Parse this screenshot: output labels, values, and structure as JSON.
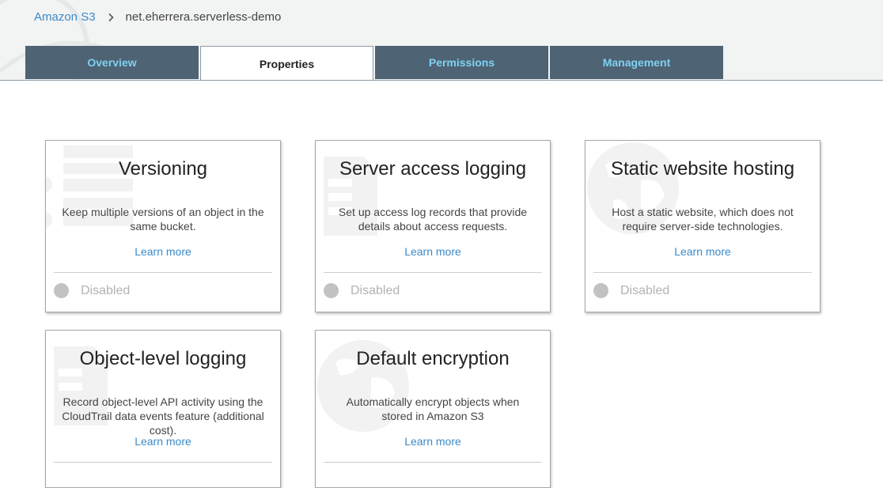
{
  "breadcrumb": {
    "root": "Amazon S3",
    "separator_icon": "chevron-right-icon",
    "current": "net.eherrera.serverless-demo"
  },
  "tabs": [
    {
      "label": "Overview",
      "active": false
    },
    {
      "label": "Properties",
      "active": true
    },
    {
      "label": "Permissions",
      "active": false
    },
    {
      "label": "Management",
      "active": false
    }
  ],
  "colors": {
    "tab_bg": "#4e6373",
    "tab_text": "#7fd1f2",
    "link": "#3b8ac8",
    "header_bg": "#f2f3f3",
    "status_dot": "#c2c2c2"
  },
  "cards": [
    {
      "title": "Versioning",
      "description": "Keep multiple versions of an object in the same bucket.",
      "link": "Learn more",
      "status": "Disabled",
      "icon": "versioning-icon"
    },
    {
      "title": "Server access logging",
      "description": "Set up access log records that provide details about access requests.",
      "link": "Learn more",
      "status": "Disabled",
      "icon": "server-logging-icon"
    },
    {
      "title": "Static website hosting",
      "description": "Host a static website, which does not require server-side technologies.",
      "link": "Learn more",
      "status": "Disabled",
      "icon": "globe-icon"
    },
    {
      "title": "Object-level logging",
      "description": "Record object-level API activity using the CloudTrail data events feature (additional cost).",
      "link": "Learn more",
      "icon": "object-logging-icon"
    },
    {
      "title": "Default encryption",
      "description": "Automatically encrypt objects when stored in Amazon S3",
      "link": "Learn more",
      "icon": "encryption-icon"
    }
  ]
}
